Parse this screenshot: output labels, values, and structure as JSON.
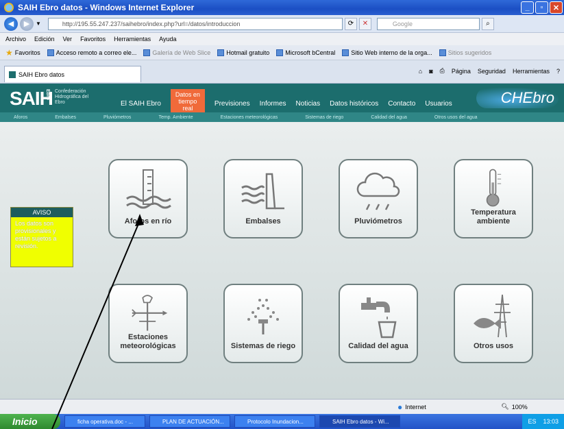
{
  "window": {
    "title": "SAIH Ebro datos - Windows Internet Explorer"
  },
  "address": {
    "url": "http://195.55.247.237/saihebro/index.php?url=/datos/introduccion",
    "search_placeholder": "Google"
  },
  "menu": [
    "Archivo",
    "Edición",
    "Ver",
    "Favoritos",
    "Herramientas",
    "Ayuda"
  ],
  "favorites": {
    "label": "Favoritos",
    "items": [
      "Acceso remoto a correo ele...",
      "Galería de Web Slice",
      "Hotmail gratuito",
      "Microsoft bCentral",
      "Sitio Web interno de la orga...",
      "Sitios sugeridos"
    ]
  },
  "tab": {
    "label": "SAIH Ebro datos"
  },
  "tools": [
    "Página",
    "Seguridad",
    "Herramientas"
  ],
  "site": {
    "logo": "SAIH",
    "logo_side": "Ebro",
    "confederacion": "Confederación Hidrográfica del Ebro",
    "nav": [
      "El SAIH Ebro",
      "Datos en tiempo real",
      "Previsiones",
      "Informes",
      "Noticias",
      "Datos históricos",
      "Contacto",
      "Usuarios"
    ],
    "brand": "CHEbro",
    "subnav": [
      "Aforos",
      "Embalses",
      "Pluviómetros",
      "Temp. Ambiente",
      "Estaciones meteorológicas",
      "Sistemas de riego",
      "Calidad del agua",
      "Otros usos del agua"
    ]
  },
  "aviso": {
    "title": "AVISO",
    "text": "Los datos son provisionales y están sujetos a revisión."
  },
  "tiles": [
    {
      "label": "Aforos en río",
      "icon": "river-gauge-icon"
    },
    {
      "label": "Embalses",
      "icon": "dam-icon"
    },
    {
      "label": "Pluviómetros",
      "icon": "rain-cloud-icon"
    },
    {
      "label": "Temperatura ambiente",
      "icon": "thermometer-icon"
    },
    {
      "label": "Estaciones meteorológicas",
      "icon": "weather-vane-icon"
    },
    {
      "label": "Sistemas de riego",
      "icon": "sprinkler-icon"
    },
    {
      "label": "Calidad del agua",
      "icon": "faucet-glass-icon"
    },
    {
      "label": "Otros usos",
      "icon": "fish-pylon-icon"
    }
  ],
  "status": {
    "zone": "Internet",
    "zoom": "100%"
  },
  "taskbar": {
    "start": "Inicio",
    "tasks": [
      "ficha operativa.doc - ...",
      "PLAN DE ACTUACIÓN...",
      "Protocolo Inundacion...",
      "SAIH Ebro datos - Wi..."
    ],
    "lang": "ES",
    "time": "13:03"
  },
  "colors": {
    "header": "#1c6d6d",
    "highlight": "#f06a3a",
    "aviso": "#f0ff00"
  }
}
